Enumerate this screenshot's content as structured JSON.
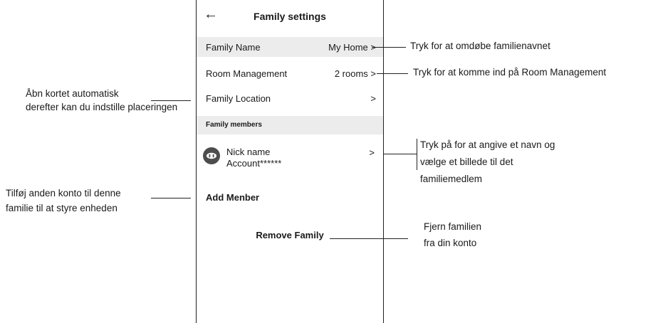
{
  "screen": {
    "title": "Family settings",
    "back_icon": "←",
    "family_name": {
      "label": "Family Name",
      "value": "My Home >"
    },
    "room_management": {
      "label": "Room Management",
      "value": "2 rooms >"
    },
    "family_location": {
      "label": "Family Location",
      "value": ">"
    },
    "members_section": "Family members",
    "member": {
      "name": "Nick name",
      "account": "Account******",
      "chevron": ">"
    },
    "add_member": "Add Menber",
    "remove_family": "Remove Family"
  },
  "annotations": {
    "rename": "Tryk for at omdøbe familienavnet",
    "room_management": "Tryk for at komme ind på Room Management",
    "location_line1": "Åbn kortet automatisk",
    "location_line2": "derefter kan du indstille placeringen",
    "member_line1": "Tryk på for at angive et navn og",
    "member_line2": "vælge et billede til det",
    "member_line3": "familiemedlem",
    "add_line1": "Tilføj anden konto til denne",
    "add_line2": "familie til at styre enheden",
    "remove_line1": "Fjern familien",
    "remove_line2": "fra din konto"
  }
}
